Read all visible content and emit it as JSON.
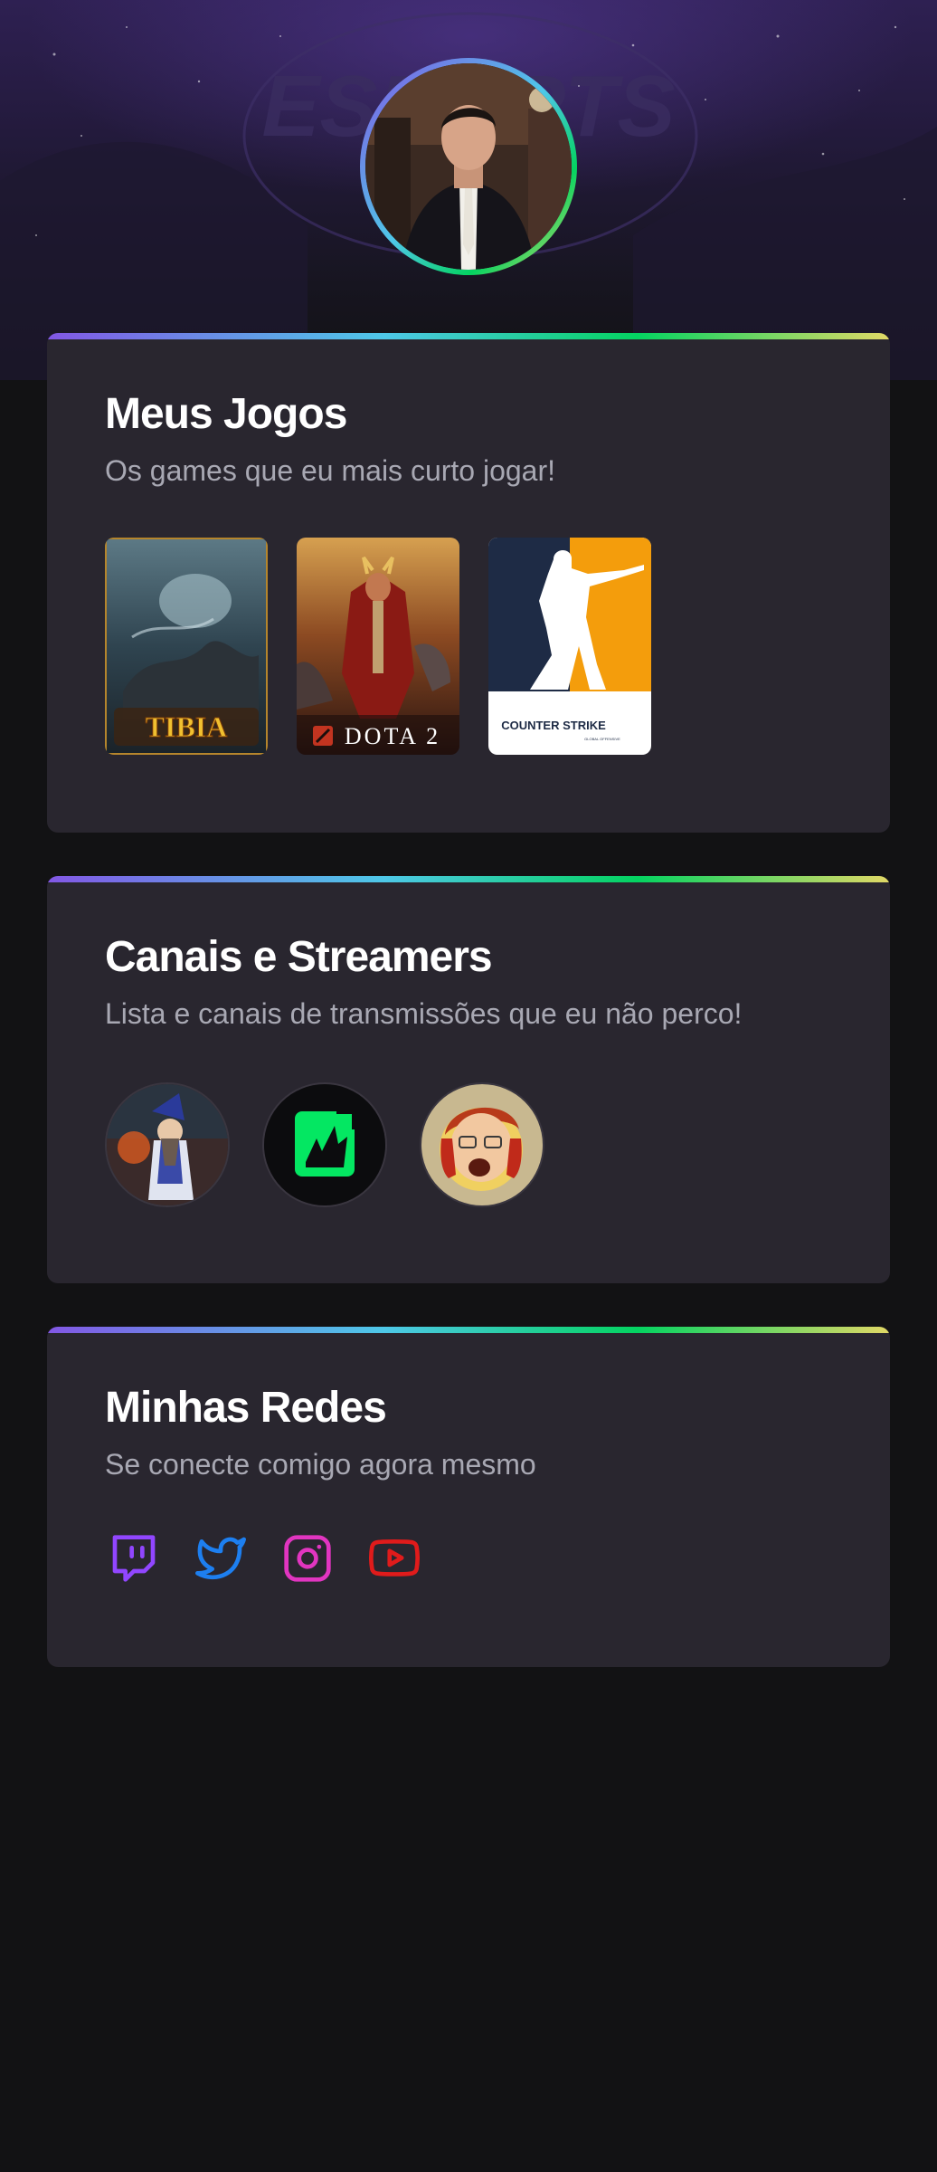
{
  "hero": {
    "background_logo_text": "ESPORTS"
  },
  "profile": {
    "avatar_alt": "Profile photo"
  },
  "sections": [
    {
      "title": "Meus Jogos",
      "subtitle": "Os games que eu mais curto jogar!"
    },
    {
      "title": "Canais e Streamers",
      "subtitle": "Lista e canais de transmissões que eu não perco!"
    },
    {
      "title": "Minhas Redes",
      "subtitle": "Se conecte comigo agora mesmo"
    }
  ],
  "games": [
    {
      "name": "Tibia",
      "label": "TIBIA"
    },
    {
      "name": "Dota 2",
      "label": "DOTA 2"
    },
    {
      "name": "Counter-Strike",
      "label": "COUNTER STRIKE",
      "sublabel": "GLOBAL OFFENSIVE"
    }
  ],
  "channels": [
    {
      "name": "wizard-channel-avatar"
    },
    {
      "name": "green-logo-channel-avatar"
    },
    {
      "name": "shouting-streamer-avatar"
    }
  ],
  "socials": [
    {
      "name": "twitch-icon",
      "color": "#9146ff"
    },
    {
      "name": "twitter-icon",
      "color": "#1d7ff0"
    },
    {
      "name": "instagram-icon",
      "color": "#e135c0"
    },
    {
      "name": "youtube-icon",
      "color": "#e01b1b"
    }
  ],
  "colors": {
    "background": "#121214",
    "card": "#29262f",
    "title": "#ffffff",
    "subtitle": "#a8a8b3",
    "accent_gradient": [
      "#8257e5",
      "#4ec8e8",
      "#04d361",
      "#e1d866"
    ]
  }
}
